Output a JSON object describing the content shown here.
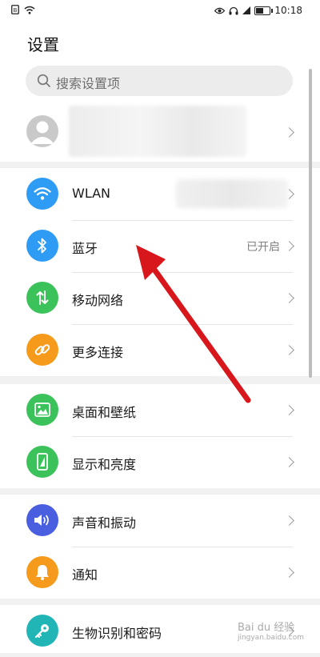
{
  "status_bar": {
    "time": "10:18"
  },
  "header": {
    "title": "设置"
  },
  "search": {
    "placeholder": "搜索设置项"
  },
  "groups": {
    "connectivity": [
      {
        "label": "WLAN",
        "value": "",
        "icon": "wifi-icon",
        "color": "#2e9cf4"
      },
      {
        "label": "蓝牙",
        "value": "已开启",
        "icon": "bluetooth-icon",
        "color": "#2e9cf4"
      },
      {
        "label": "移动网络",
        "value": "",
        "icon": "mobile-data-icon",
        "color": "#3cc25a"
      },
      {
        "label": "更多连接",
        "value": "",
        "icon": "link-icon",
        "color": "#f59a1b"
      }
    ],
    "display": [
      {
        "label": "桌面和壁纸",
        "icon": "wallpaper-icon",
        "color": "#3cc25a"
      },
      {
        "label": "显示和亮度",
        "icon": "display-icon",
        "color": "#3cc25a"
      }
    ],
    "sound": [
      {
        "label": "声音和振动",
        "icon": "sound-icon",
        "color": "#4a5ee0"
      },
      {
        "label": "通知",
        "icon": "bell-icon",
        "color": "#f59a1b"
      }
    ],
    "security": [
      {
        "label": "生物识别和密码",
        "icon": "key-icon",
        "color": "#21b5b5"
      }
    ]
  },
  "watermark": {
    "brand": "Bai du 经验",
    "sub": "jingyan.baidu.com"
  },
  "annotation": {
    "color": "#d8171c"
  }
}
